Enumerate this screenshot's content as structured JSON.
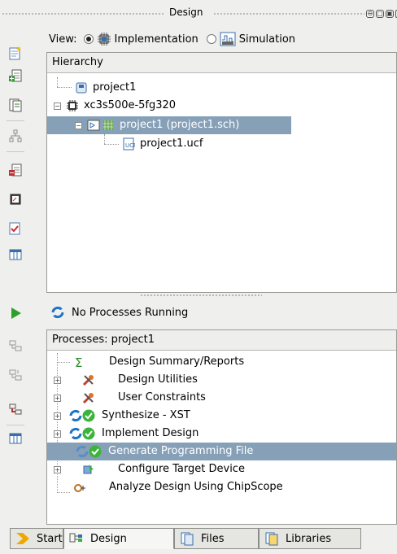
{
  "window": {
    "title": "Design",
    "buttons": [
      "float-icon",
      "restore-icon",
      "maximize-icon",
      "close-icon"
    ]
  },
  "view": {
    "label": "View:",
    "options": [
      {
        "label": "Implementation",
        "selected": true
      },
      {
        "label": "Simulation",
        "selected": false
      }
    ]
  },
  "hierarchy": {
    "header": "Hierarchy",
    "items": [
      {
        "label": "project1",
        "icon": "project-icon"
      },
      {
        "label": "xc3s500e-5fg320",
        "icon": "chip-icon"
      },
      {
        "label": "project1 (project1.sch)",
        "icon": "schematic-icon",
        "selected": true
      },
      {
        "label": "project1.ucf",
        "icon": "ucf-file-icon"
      }
    ]
  },
  "status": {
    "text": "No Processes Running"
  },
  "processes": {
    "header": "Processes: project1",
    "items": [
      {
        "label": "Design Summary/Reports",
        "icon": "sigma-icon"
      },
      {
        "label": "Design Utilities",
        "icon": "tools-icon"
      },
      {
        "label": "User Constraints",
        "icon": "tools-icon"
      },
      {
        "label": "Synthesize - XST",
        "icon": "run-check-icon"
      },
      {
        "label": "Implement Design",
        "icon": "run-check-icon"
      },
      {
        "label": "Generate Programming File",
        "icon": "run-check-icon",
        "selected": true
      },
      {
        "label": "Configure Target Device",
        "icon": "configure-icon"
      },
      {
        "label": "Analyze Design Using ChipScope",
        "icon": "chipscope-icon"
      }
    ]
  },
  "tabs": [
    {
      "label": "Start",
      "active": false
    },
    {
      "label": "Design",
      "active": true
    },
    {
      "label": "Files",
      "active": false
    },
    {
      "label": "Libraries",
      "active": false
    }
  ],
  "colors": {
    "selection": "#86a0b8",
    "check_green": "#3cb43c",
    "run_blue": "#1d74c6",
    "play_green": "#2ca02c"
  }
}
